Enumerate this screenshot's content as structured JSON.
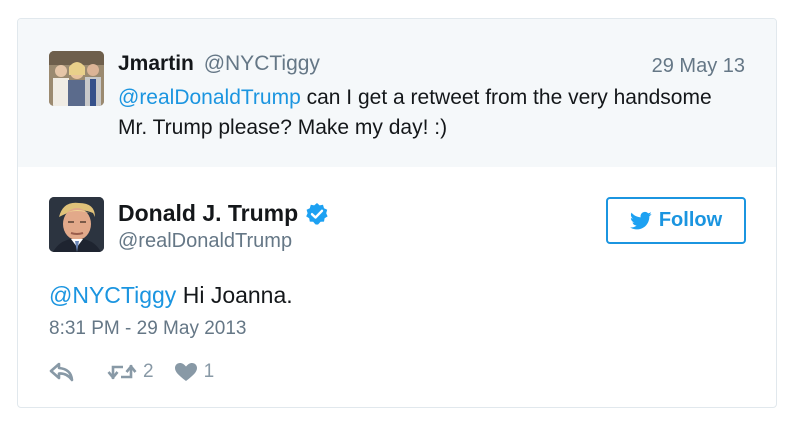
{
  "parent_tweet": {
    "name": "Jmartin",
    "handle": "@NYCTiggy",
    "date": "29 May 13",
    "mention": "@realDonaldTrump",
    "text": " can I get a retweet from the very handsome Mr. Trump please? Make my day! :)"
  },
  "main_tweet": {
    "name": "Donald J. Trump",
    "handle": "@realDonaldTrump",
    "follow_label": "Follow",
    "mention": "@NYCTiggy",
    "text": " Hi Joanna.",
    "timestamp": "8:31 PM - 29 May 2013",
    "retweet_count": "2",
    "like_count": "1"
  },
  "colors": {
    "link": "#1b95e0",
    "muted": "#657786",
    "icon": "#8899a6",
    "parent_bg": "#f5f8fa"
  },
  "icons": [
    "reply-icon",
    "retweet-icon",
    "heart-icon",
    "verified-badge-icon",
    "twitter-bird-icon"
  ]
}
